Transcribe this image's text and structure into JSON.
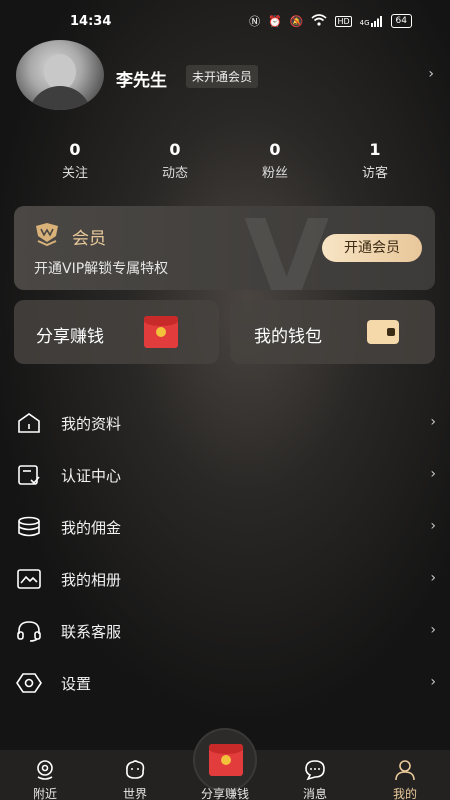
{
  "status_bar": {
    "time": "14:34",
    "battery": "64",
    "hd": "HD",
    "network": "4G",
    "icon_names": [
      "nfc-icon",
      "alarm-icon",
      "mute-icon",
      "wifi-icon",
      "hd-icon",
      "signal-icon",
      "battery-icon"
    ]
  },
  "profile": {
    "name": "李先生",
    "badge": "未开通会员"
  },
  "stats": [
    {
      "num": "0",
      "label": "关注"
    },
    {
      "num": "0",
      "label": "动态"
    },
    {
      "num": "0",
      "label": "粉丝"
    },
    {
      "num": "1",
      "label": "访客"
    }
  ],
  "vip": {
    "title": "会员",
    "subtitle": "开通VIP解锁专属特权",
    "button": "开通会员",
    "watermark": "V"
  },
  "actions": {
    "share": "分享赚钱",
    "wallet": "我的钱包"
  },
  "menu": [
    {
      "label": "我的资料",
      "icon": "home-icon"
    },
    {
      "label": "认证中心",
      "icon": "certificate-icon"
    },
    {
      "label": "我的佣金",
      "icon": "coins-icon"
    },
    {
      "label": "我的相册",
      "icon": "photo-album-icon"
    },
    {
      "label": "联系客服",
      "icon": "headset-icon"
    },
    {
      "label": "设置",
      "icon": "settings-icon"
    }
  ],
  "tabs": [
    {
      "label": "附近",
      "icon": "location-icon"
    },
    {
      "label": "世界",
      "icon": "world-icon"
    },
    {
      "label": "分享赚钱",
      "icon": "red-packet-icon"
    },
    {
      "label": "消息",
      "icon": "message-icon"
    },
    {
      "label": "我的",
      "icon": "user-icon"
    }
  ],
  "colors": {
    "gold": "#e9c99a",
    "red_packet": "#e23c3c",
    "tab_bg": "#232221"
  }
}
